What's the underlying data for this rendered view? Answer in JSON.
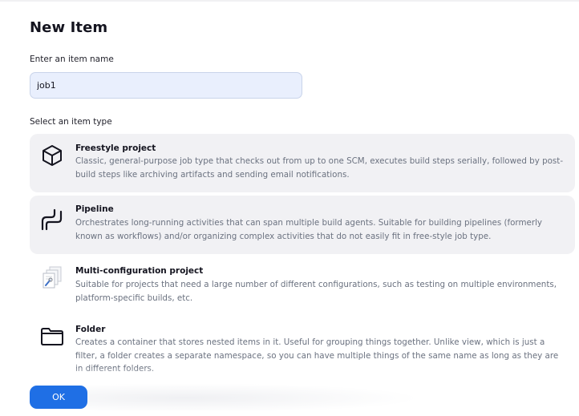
{
  "page": {
    "title": "New Item"
  },
  "name_field": {
    "label": "Enter an item name",
    "value": "job1"
  },
  "type_section": {
    "label": "Select an item type"
  },
  "item_types": [
    {
      "name": "Freestyle project",
      "icon": "cube-icon",
      "description": "Classic, general-purpose job type that checks out from up to one SCM, executes build steps serially, followed by post-build steps like archiving artifacts and sending email notifications."
    },
    {
      "name": "Pipeline",
      "icon": "pipeline-icon",
      "description": "Orchestrates long-running activities that can span multiple build agents. Suitable for building pipelines (formerly known as workflows) and/or organizing complex activities that do not easily fit in free-style job type."
    },
    {
      "name": "Multi-configuration project",
      "icon": "multi-config-icon",
      "description": "Suitable for projects that need a large number of different configurations, such as testing on multiple environments, platform-specific builds, etc."
    },
    {
      "name": "Folder",
      "icon": "folder-icon",
      "description": "Creates a container that stores nested items in it. Useful for grouping things together. Unlike view, which is just a filter, a folder creates a separate namespace, so you can have multiple things of the same name as long as they are in different folders."
    }
  ],
  "footer": {
    "ok_label": "OK"
  },
  "colors": {
    "primary": "#1f6fe5",
    "input_bg": "#e9effd",
    "card_bg": "#f1f1f4",
    "muted_text": "#6b7280"
  }
}
